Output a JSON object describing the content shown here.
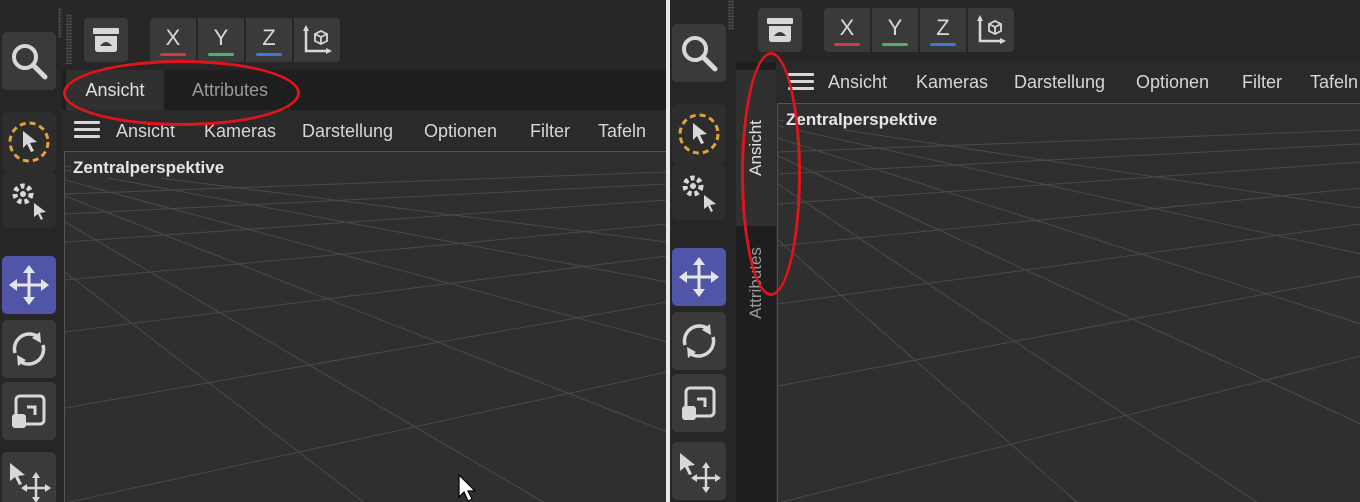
{
  "axes": {
    "x": "X",
    "y": "Y",
    "z": "Z"
  },
  "axis_colors": {
    "x": "#d23b3b",
    "y": "#4bb36a",
    "z": "#3b7bd2"
  },
  "accent_active": "#5055a8",
  "annotation_color": "#e2141b",
  "tabs": {
    "view": "Ansicht",
    "attributes": "Attributes"
  },
  "menu": {
    "view": "Ansicht",
    "cameras": "Kameras",
    "display": "Darstellung",
    "options": "Optionen",
    "filter": "Filter",
    "panels": "Tafeln"
  },
  "viewport": {
    "label": "Zentralperspektive"
  },
  "icons": {
    "search": "search-icon",
    "layout": "layout-icon",
    "selection": "live-selection-icon",
    "tool_settings": "tool-settings-icon",
    "move": "move-icon",
    "rotate": "rotate-icon",
    "scale": "scale-icon",
    "transform": "transform-icon",
    "coordinate_system": "coordinate-system-icon",
    "cursor": "mouse-cursor-icon"
  }
}
